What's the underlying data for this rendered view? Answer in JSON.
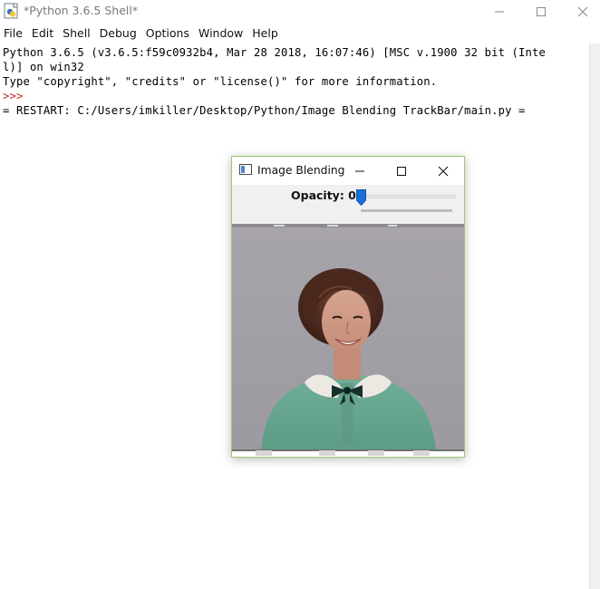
{
  "shell": {
    "title": "*Python 3.6.5 Shell*",
    "menu": [
      "File",
      "Edit",
      "Shell",
      "Debug",
      "Options",
      "Window",
      "Help"
    ],
    "lines": {
      "line1": "Python 3.6.5 (v3.6.5:f59c0932b4, Mar 28 2018, 16:07:46) [MSC v.1900 32 bit (Inte",
      "line2": "l)] on win32",
      "line3": "Type \"copyright\", \"credits\" or \"license()\" for more information.",
      "prompt": ">>>",
      "restart": "= RESTART: C:/Users/imkiller/Desktop/Python/Image Blending TrackBar/main.py ="
    }
  },
  "blend_window": {
    "title": "Image Blending",
    "opacity_label": "Opacity: 0",
    "opacity_value": 0,
    "image": "photo of smiling woman with dark bouffant hair wearing green jacket and white collar with black bow"
  },
  "colors": {
    "prompt": "#cc2222",
    "accent_border": "#9fc96c",
    "slider_thumb": "#1a6fd6"
  },
  "icons": [
    "python-shell-icon",
    "minimize-icon",
    "maximize-icon",
    "close-icon",
    "window-app-icon",
    "slider-thumb-icon"
  ]
}
